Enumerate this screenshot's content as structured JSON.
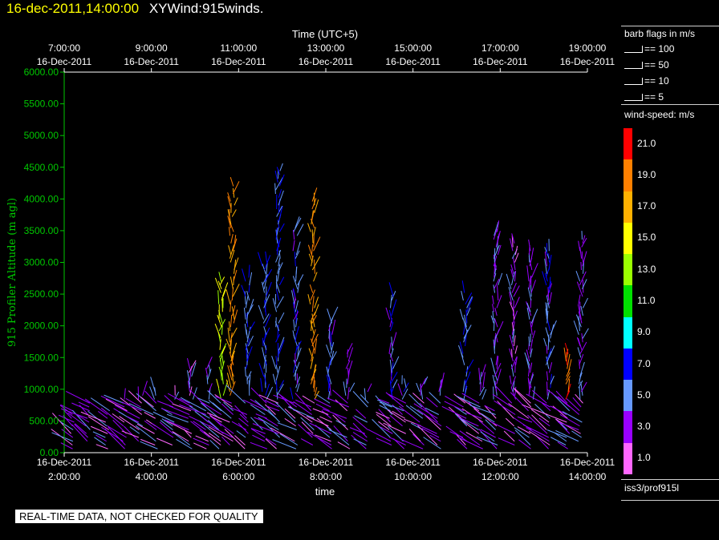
{
  "header": {
    "datetime": "16-dec-2011,14:00:00",
    "product": "XYWind:915winds."
  },
  "legend": {
    "barb_title": "barb flags in m/s",
    "barb_flags": [
      "== 100",
      "== 50",
      "== 10",
      "== 5"
    ],
    "speed_title": "wind-speed: m/s",
    "speed_levels": [
      "21.0",
      "19.0",
      "17.0",
      "15.0",
      "13.0",
      "11.0",
      "9.0",
      "7.0",
      "5.0",
      "3.0",
      "1.0"
    ],
    "speed_colors": [
      "#ff0000",
      "#ff8000",
      "#ffb000",
      "#ffff00",
      "#9aff00",
      "#00e000",
      "#00ffff",
      "#0000ff",
      "#6699ff",
      "#9900ff",
      "#ff66ff"
    ]
  },
  "source": "iss3/prof915l",
  "disclaimer": "REAL-TIME DATA, NOT CHECKED FOR QUALITY",
  "chart_data": {
    "type": "scatter",
    "ylabel": "915 Profiler Altitude (m agl)",
    "xlabel": "time",
    "top_xlabel": "Time (UTC+5)",
    "yticks": [
      "0.00",
      "500.00",
      "1000.00",
      "1500.00",
      "2000.00",
      "2500.00",
      "3000.00",
      "3500.00",
      "4000.00",
      "4500.00",
      "5000.00",
      "5500.00",
      "6000.00"
    ],
    "ylim": [
      0,
      6000
    ],
    "bottom_ticks": [
      {
        "date": "16-Dec-2011",
        "time": "2:00:00"
      },
      {
        "date": "16-Dec-2011",
        "time": "4:00:00"
      },
      {
        "date": "16-Dec-2011",
        "time": "6:00:00"
      },
      {
        "date": "16-Dec-2011",
        "time": "8:00:00"
      },
      {
        "date": "16-Dec-2011",
        "time": "10:00:00"
      },
      {
        "date": "16-Dec-2011",
        "time": "12:00:00"
      },
      {
        "date": "16-Dec-2011",
        "time": "14:00:00"
      }
    ],
    "top_ticks": [
      {
        "time": "7:00:00",
        "date": "16-Dec-2011"
      },
      {
        "time": "9:00:00",
        "date": "16-Dec-2011"
      },
      {
        "time": "11:00:00",
        "date": "16-Dec-2011"
      },
      {
        "time": "13:00:00",
        "date": "16-Dec-2011"
      },
      {
        "time": "15:00:00",
        "date": "16-Dec-2011"
      },
      {
        "time": "17:00:00",
        "date": "16-Dec-2011"
      },
      {
        "time": "19:00:00",
        "date": "16-Dec-2011"
      }
    ],
    "x_hours_range": [
      2,
      14
    ],
    "grid": false,
    "profiles": [
      {
        "hour": 2.2,
        "top": 700,
        "speed": 4
      },
      {
        "hour": 2.55,
        "top": 800,
        "speed": 6
      },
      {
        "hour": 3.0,
        "top": 700,
        "speed": 5
      },
      {
        "hour": 3.4,
        "top": 850,
        "speed": 4
      },
      {
        "hour": 3.75,
        "top": 900,
        "speed": 3
      },
      {
        "hour": 4.1,
        "top": 1000,
        "speed": 5
      },
      {
        "hour": 4.5,
        "top": 900,
        "speed": 3
      },
      {
        "hour": 4.9,
        "top": 1350,
        "speed": 3
      },
      {
        "hour": 5.3,
        "top": 1350,
        "speed": 4
      },
      {
        "hour": 5.6,
        "top": 2700,
        "speed": 14
      },
      {
        "hour": 5.85,
        "top": 4200,
        "speed": 18
      },
      {
        "hour": 6.2,
        "top": 2800,
        "speed": 6
      },
      {
        "hour": 6.6,
        "top": 3000,
        "speed": 6
      },
      {
        "hour": 6.9,
        "top": 4450,
        "speed": 6
      },
      {
        "hour": 7.3,
        "top": 3550,
        "speed": 5
      },
      {
        "hour": 7.7,
        "top": 4000,
        "speed": 18
      },
      {
        "hour": 8.1,
        "top": 2100,
        "speed": 5
      },
      {
        "hour": 8.5,
        "top": 1600,
        "speed": 4
      },
      {
        "hour": 8.95,
        "top": 1000,
        "speed": 4
      },
      {
        "hour": 9.5,
        "top": 2500,
        "speed": 5
      },
      {
        "hour": 9.8,
        "top": 1100,
        "speed": 5
      },
      {
        "hour": 10.2,
        "top": 1100,
        "speed": 4
      },
      {
        "hour": 10.6,
        "top": 1100,
        "speed": 4
      },
      {
        "hour": 11.2,
        "top": 2600,
        "speed": 6
      },
      {
        "hour": 11.55,
        "top": 1200,
        "speed": 4
      },
      {
        "hour": 11.9,
        "top": 3500,
        "speed": 4
      },
      {
        "hour": 12.3,
        "top": 3300,
        "speed": 3
      },
      {
        "hour": 12.7,
        "top": 3200,
        "speed": 4
      },
      {
        "hour": 13.1,
        "top": 3200,
        "speed": 5
      },
      {
        "hour": 13.55,
        "top": 1600,
        "speed": 20
      },
      {
        "hour": 13.85,
        "top": 3400,
        "speed": 4
      }
    ]
  }
}
